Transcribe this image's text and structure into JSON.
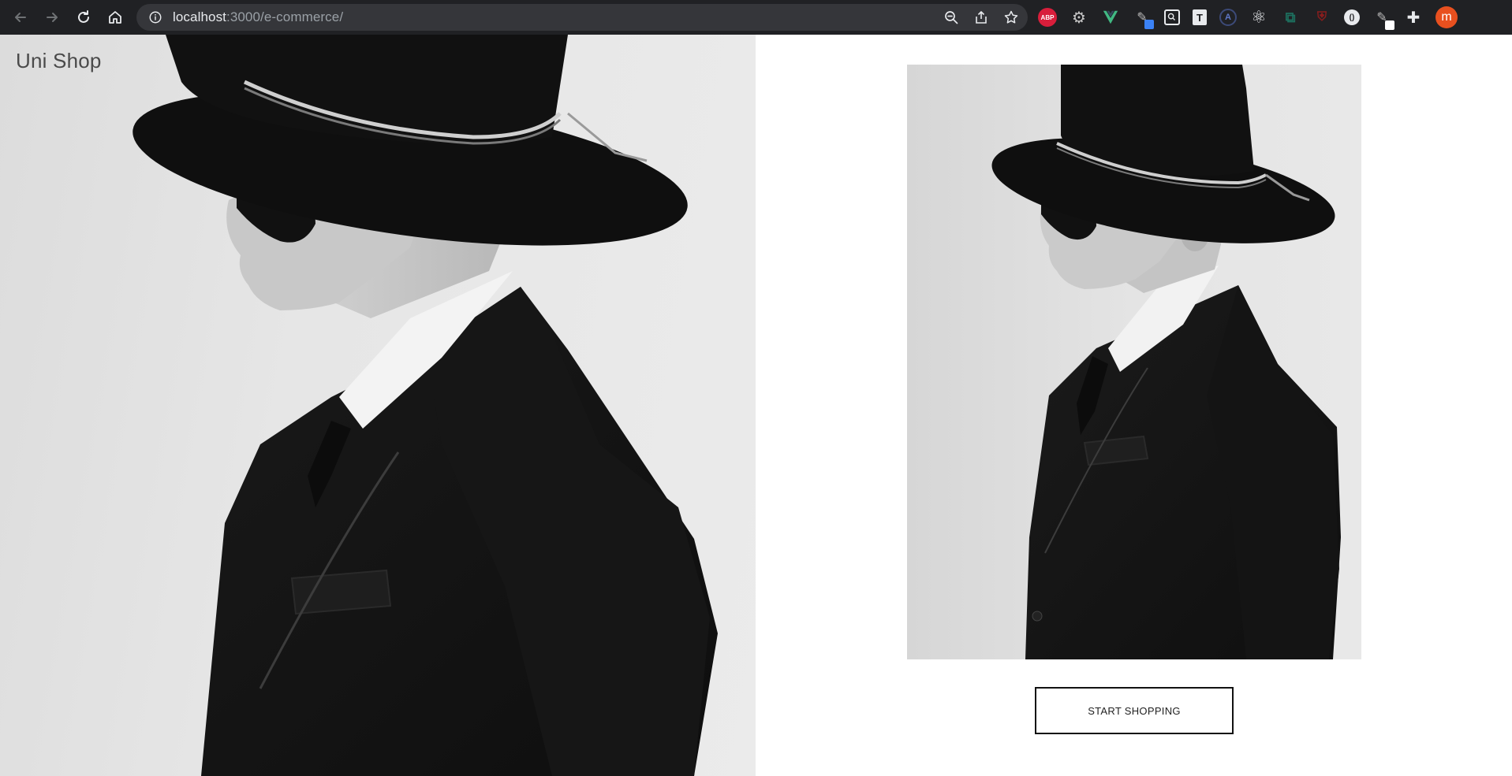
{
  "browser": {
    "url_host": "localhost",
    "url_path": ":3000/e-commerce/",
    "extensions": [
      {
        "name": "adblock-plus",
        "label": "ABP"
      },
      {
        "name": "settings-gear",
        "label": ""
      },
      {
        "name": "vue-devtools",
        "label": ""
      },
      {
        "name": "color-picker",
        "label": ""
      },
      {
        "name": "screen-search",
        "label": ""
      },
      {
        "name": "text-tool",
        "label": "T"
      },
      {
        "name": "a-extension",
        "label": "A"
      },
      {
        "name": "react-devtools",
        "label": ""
      },
      {
        "name": "frame-tool",
        "label": ""
      },
      {
        "name": "shield",
        "label": ""
      },
      {
        "name": "ring-extension",
        "label": "()"
      },
      {
        "name": "pen-tool",
        "label": ""
      },
      {
        "name": "extensions-puzzle",
        "label": ""
      }
    ],
    "profile_initial": "m"
  },
  "page": {
    "brand": "Uni Shop",
    "cta_label": "START SHOPPING"
  },
  "colors": {
    "chrome_bg": "#202124",
    "omnibox_bg": "#35363a",
    "avatar": "#e8501f",
    "abp": "#d81e3b"
  }
}
